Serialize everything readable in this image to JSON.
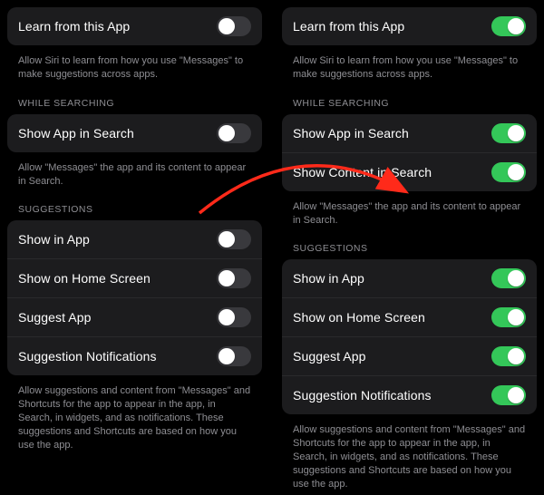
{
  "colors": {
    "accent_on": "#34c759",
    "toggle_off": "#39393d",
    "arrow": "#ff2a1a"
  },
  "left": {
    "learn": {
      "label": "Learn from this App",
      "value": false
    },
    "learn_footer": "Allow Siri to learn from how you use \"Messages\" to make suggestions across apps.",
    "search_header": "WHILE SEARCHING",
    "search": [
      {
        "label": "Show App in Search",
        "value": false
      }
    ],
    "search_footer": "Allow \"Messages\" the app and its content to appear in Search.",
    "suggestions_header": "SUGGESTIONS",
    "suggestions": [
      {
        "label": "Show in App",
        "value": false
      },
      {
        "label": "Show on Home Screen",
        "value": false
      },
      {
        "label": "Suggest App",
        "value": false
      },
      {
        "label": "Suggestion Notifications",
        "value": false
      }
    ],
    "suggestions_footer": "Allow suggestions and content from \"Messages\" and Shortcuts for the app to appear in the app, in Search, in widgets, and as notifications. These suggestions and Shortcuts are based on how you use the app."
  },
  "right": {
    "learn": {
      "label": "Learn from this App",
      "value": true
    },
    "learn_footer": "Allow Siri to learn from how you use \"Messages\" to make suggestions across apps.",
    "search_header": "WHILE SEARCHING",
    "search": [
      {
        "label": "Show App in Search",
        "value": true
      },
      {
        "label": "Show Content in Search",
        "value": true
      }
    ],
    "search_footer": "Allow \"Messages\" the app and its content to appear in Search.",
    "suggestions_header": "SUGGESTIONS",
    "suggestions": [
      {
        "label": "Show in App",
        "value": true
      },
      {
        "label": "Show on Home Screen",
        "value": true
      },
      {
        "label": "Suggest App",
        "value": true
      },
      {
        "label": "Suggestion Notifications",
        "value": true
      }
    ],
    "suggestions_footer": "Allow suggestions and content from \"Messages\" and Shortcuts for the app to appear in the app, in Search, in widgets, and as notifications. These suggestions and Shortcuts are based on how you use the app."
  }
}
